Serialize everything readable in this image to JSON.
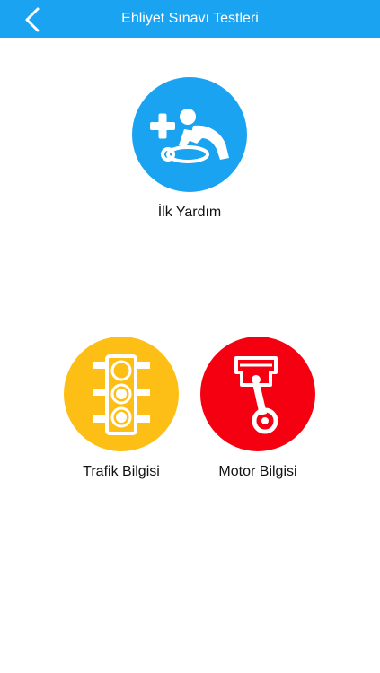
{
  "header": {
    "title": "Ehliyet Sınavı Testleri",
    "back_icon": "chevron-left-icon"
  },
  "categories": [
    {
      "label": "İlk Yardım",
      "icon": "first-aid-cpr-icon",
      "color": "#1aa3f0"
    },
    {
      "label": "Trafik Bilgisi",
      "icon": "traffic-light-icon",
      "color": "#fdbf16"
    },
    {
      "label": "Motor Bilgisi",
      "icon": "engine-piston-icon",
      "color": "#f50011"
    }
  ],
  "colors": {
    "header_bg": "#1aa3f0",
    "header_text": "#ffffff",
    "label_text": "#111111",
    "background": "#ffffff"
  }
}
